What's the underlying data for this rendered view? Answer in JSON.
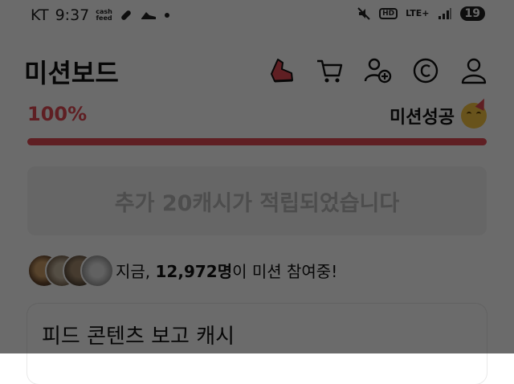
{
  "status_bar": {
    "carrier": "KT",
    "time": "9:37",
    "cashfeed_top": "cash",
    "cashfeed_bottom": "feed",
    "hd": "HD",
    "network": "LTE+",
    "battery": "19"
  },
  "header": {
    "title": "미션보드",
    "icons": [
      "shoe-icon",
      "cart-icon",
      "add-friend-icon",
      "coin-icon",
      "profile-icon"
    ]
  },
  "mission": {
    "progress_text": "100%",
    "progress_value": 1.0,
    "status_label": "미션성공",
    "reward_text": "추가 20캐시가 적립되었습니다"
  },
  "participants": {
    "prefix": "지금, ",
    "count": "12,972명",
    "suffix": "이 미션 참여중!"
  },
  "feed_card": {
    "title": "피드 콘텐츠 보고 캐시"
  },
  "colors": {
    "accent": "#e24b55",
    "bar_track": "#f1d6d8",
    "reward_box": "#f2f2f2",
    "reward_text": "#b7b7b7"
  }
}
